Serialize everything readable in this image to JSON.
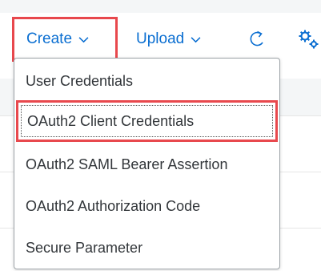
{
  "toolbar": {
    "create_label": "Create",
    "upload_label": "Upload"
  },
  "menu": {
    "items": [
      {
        "label": "User Credentials"
      },
      {
        "label": "OAuth2 Client Credentials",
        "selected": true
      },
      {
        "label": "OAuth2 SAML Bearer Assertion"
      },
      {
        "label": "OAuth2 Authorization Code"
      },
      {
        "label": "Secure Parameter"
      }
    ]
  },
  "colors": {
    "accent": "#0a6ed1",
    "highlight": "#e8484d",
    "text": "#32363a"
  },
  "icons": [
    "chevron-down-icon",
    "refresh-icon",
    "settings-icon"
  ]
}
